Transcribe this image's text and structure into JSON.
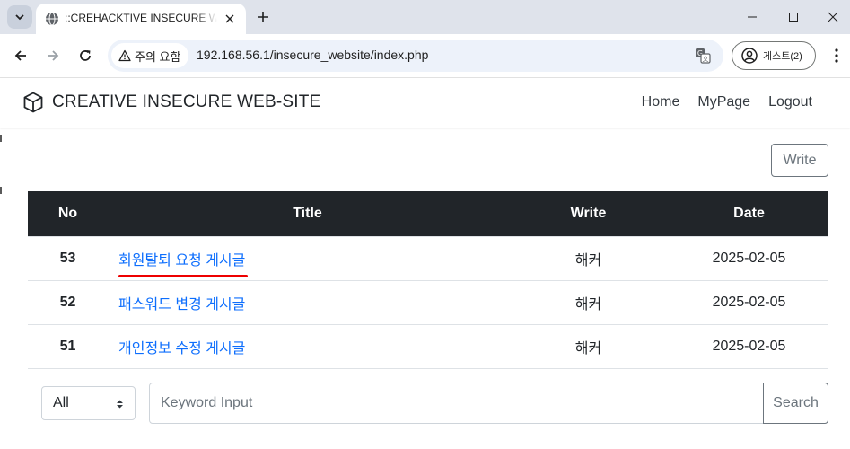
{
  "browser": {
    "tab_title": "::CREHACKTIVE INSECURE WEBSITE::",
    "security_label": "주의 요함",
    "url": "192.168.56.1/insecure_website/index.php",
    "profile_label": "게스트(2)",
    "icons": {
      "tab_search": "chevron-down-icon",
      "favicon": "globe-icon",
      "close": "close-icon",
      "new_tab": "plus-icon",
      "back": "back-arrow-icon",
      "forward": "forward-arrow-icon",
      "reload": "reload-icon",
      "warning": "warning-triangle-icon",
      "translate": "translate-icon",
      "profile": "person-circle-icon",
      "menu": "kebab-menu-icon"
    }
  },
  "site": {
    "brand": "CREATIVE INSECURE WEB-SITE",
    "nav": [
      "Home",
      "MyPage",
      "Logout"
    ],
    "write_button": "Write"
  },
  "board": {
    "columns": [
      "No",
      "Title",
      "Write",
      "Date"
    ],
    "rows": [
      {
        "no": "53",
        "title": "회원탈퇴 요청 게시글",
        "writer": "해커",
        "date": "2025-02-05",
        "underlined": true
      },
      {
        "no": "52",
        "title": "패스워드 변경 게시글",
        "writer": "해커",
        "date": "2025-02-05",
        "underlined": false
      },
      {
        "no": "51",
        "title": "개인정보 수정 게시글",
        "writer": "해커",
        "date": "2025-02-05",
        "underlined": false
      }
    ]
  },
  "search": {
    "selected_option": "All",
    "placeholder": "Keyword Input",
    "button": "Search"
  },
  "colors": {
    "link": "#0d6efd",
    "table_header": "#212529",
    "annotation_underline": "#ee0000"
  }
}
